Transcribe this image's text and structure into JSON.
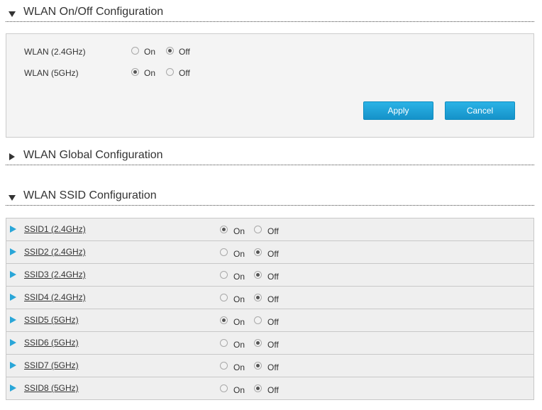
{
  "onoff_section": {
    "title": "WLAN On/Off Configuration",
    "rows": [
      {
        "label": "WLAN (2.4GHz)",
        "on_label": "On",
        "off_label": "Off",
        "selected": "Off"
      },
      {
        "label": "WLAN (5GHz)",
        "on_label": "On",
        "off_label": "Off",
        "selected": "On"
      }
    ],
    "apply_label": "Apply",
    "cancel_label": "Cancel"
  },
  "global_section": {
    "title": "WLAN Global Configuration"
  },
  "ssid_section": {
    "title": "WLAN SSID Configuration",
    "on_label": "On",
    "off_label": "Off",
    "rows": [
      {
        "name": "SSID1 (2.4GHz)",
        "selected": "On"
      },
      {
        "name": "SSID2 (2.4GHz)",
        "selected": "Off"
      },
      {
        "name": "SSID3 (2.4GHz)",
        "selected": "Off"
      },
      {
        "name": "SSID4 (2.4GHz)",
        "selected": "Off"
      },
      {
        "name": "SSID5 (5GHz)",
        "selected": "On"
      },
      {
        "name": "SSID6 (5GHz)",
        "selected": "Off"
      },
      {
        "name": "SSID7 (5GHz)",
        "selected": "Off"
      },
      {
        "name": "SSID8 (5GHz)",
        "selected": "Off"
      }
    ]
  },
  "colors": {
    "button_blue": "#1a9fd6",
    "ssid_arrow": "#29a6d8",
    "row_bg": "#efefef",
    "panel_bg": "#f4f4f4"
  },
  "icons": {
    "section_expanded": "triangle-down-icon",
    "section_collapsed": "triangle-right-icon",
    "ssid_expand": "triangle-right-blue-icon"
  }
}
